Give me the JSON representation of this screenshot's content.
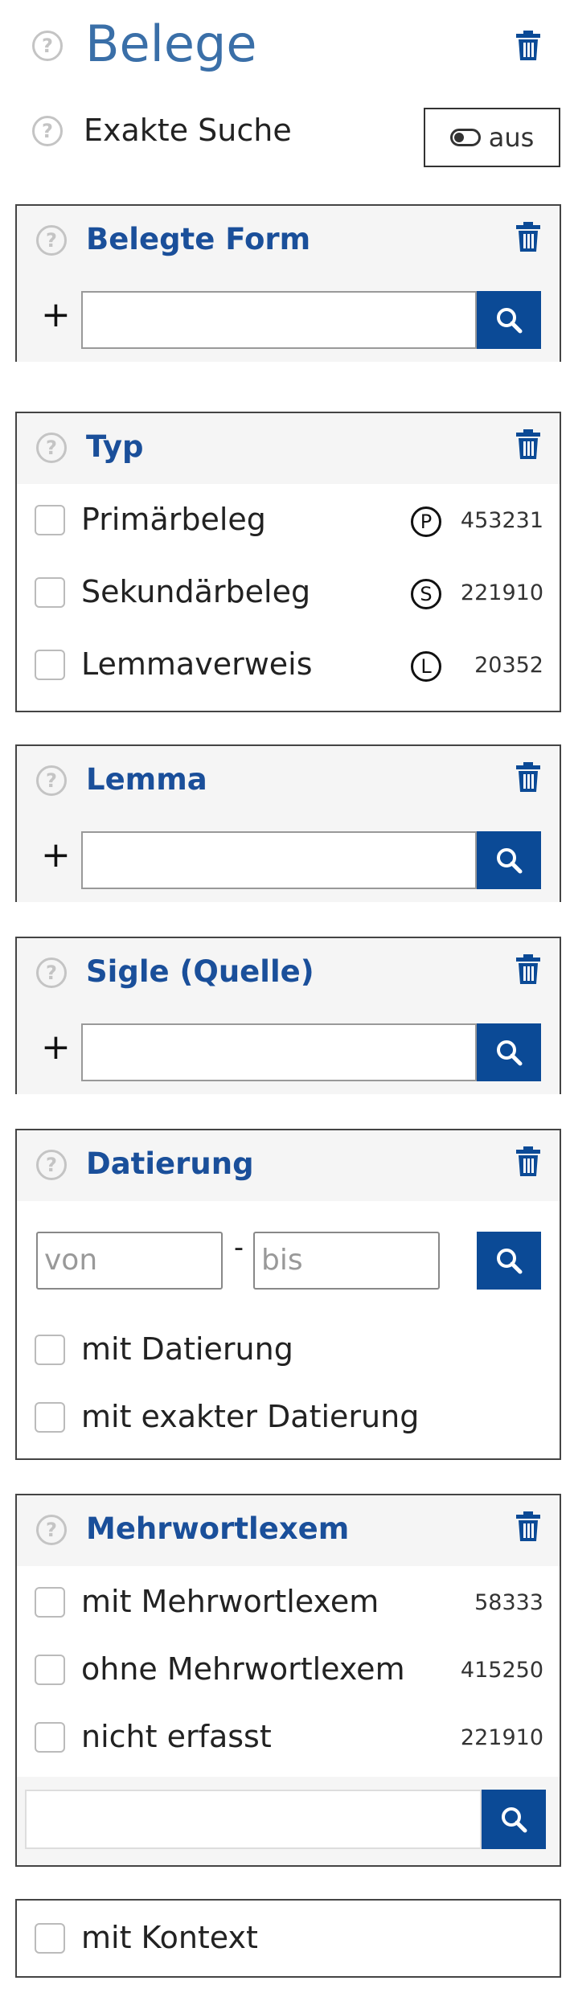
{
  "header": {
    "title": "Belege",
    "exact_search_label": "Exakte Suche",
    "exact_search_toggle": "aus"
  },
  "belegte_form": {
    "title": "Belegte Form",
    "plus": "+"
  },
  "typ": {
    "title": "Typ",
    "options": [
      {
        "label": "Primärbeleg",
        "badge": "P",
        "count": "453231"
      },
      {
        "label": "Sekundärbeleg",
        "badge": "S",
        "count": "221910"
      },
      {
        "label": "Lemmaverweis",
        "badge": "L",
        "count": "20352"
      }
    ]
  },
  "lemma": {
    "title": "Lemma",
    "plus": "+"
  },
  "sigle": {
    "title": "Sigle (Quelle)",
    "plus": "+"
  },
  "datierung": {
    "title": "Datierung",
    "from_placeholder": "von",
    "separator": "-",
    "to_placeholder": "bis",
    "options": [
      "mit Datierung",
      "mit exakter Datierung"
    ]
  },
  "mehrwortlexem": {
    "title": "Mehrwortlexem",
    "options": [
      {
        "label": "mit Mehrwortlexem",
        "count": "58333"
      },
      {
        "label": "ohne Mehrwortlexem",
        "count": "415250"
      },
      {
        "label": "nicht erfasst",
        "count": "221910"
      }
    ]
  },
  "kontext": {
    "label": "mit Kontext"
  },
  "colors": {
    "accent": "#0b4a96",
    "title": "#1a4f9a",
    "page_title": "#3a6fa8",
    "help": "#c4c4c4"
  },
  "icons": {
    "help": "help-icon",
    "trash": "trash-icon",
    "search": "search-icon",
    "toggle": "toggle-icon"
  }
}
